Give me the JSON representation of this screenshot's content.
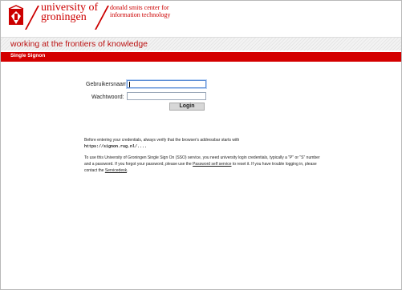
{
  "header": {
    "university_line1": "university of",
    "university_line2": "groningen",
    "center_line1": "donald smits center for",
    "center_line2": "information technology"
  },
  "tagline": "working at the frontiers of knowledge",
  "section_title": "Single Signon",
  "form": {
    "username_label": "Gebruikersnaam:",
    "password_label": "Wachtwoord:",
    "username_value": "",
    "password_value": "",
    "login_label": "Login"
  },
  "info": {
    "line1": "Before entering your credentials, always verify that the browser's addressbar starts with",
    "url": "https://signon.rug.nl/....",
    "p2_part1": "To use this University of Groningen Single Sign On (SSO) service, you need university login credentials, typically a \"P\" or \"S\" number and a password. If you forgot your password, please use the",
    "password_link": "Password self service",
    "p2_part2": "to reset it. If you have trouble logging in, please contact the",
    "servicedesk_link": "Servicedesk",
    "p2_end": "."
  },
  "colors": {
    "brand_red": "#d40000"
  }
}
